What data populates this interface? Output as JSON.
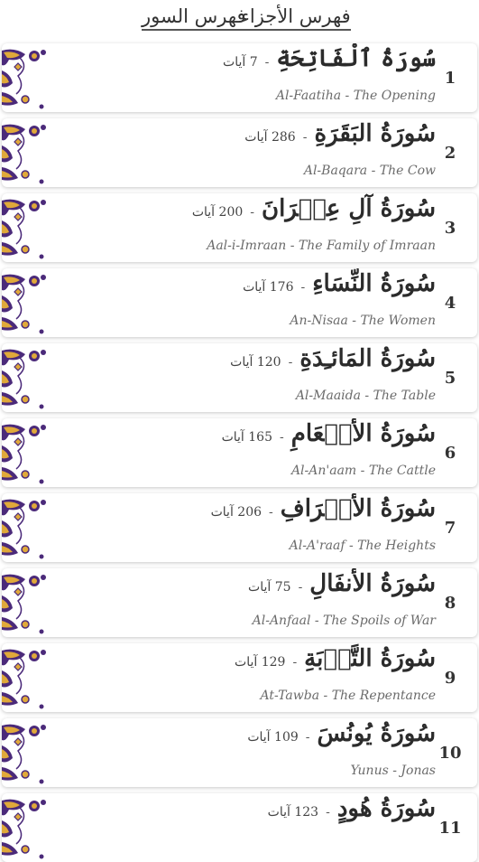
{
  "tabs": {
    "juz_index": "فهرس الأجزاء",
    "surah_index": "فهرس السور"
  },
  "colors": {
    "ornament_purple": "#4b2a7a",
    "ornament_gold": "#e0a93a"
  },
  "surahs": [
    {
      "number": "1",
      "arabic": "سُورَةُ ٱلْفَاتِحَةِ",
      "ayat": "7 آيات",
      "english": "Al-Faatiha - The Opening"
    },
    {
      "number": "2",
      "arabic": "سُورَةُ البَقَرَةِ",
      "ayat": "286 آيات",
      "english": "Al-Baqara - The Cow"
    },
    {
      "number": "3",
      "arabic": "سُورَةُ آلِ عِمۡرَانَ",
      "ayat": "200 آيات",
      "english": "Aal-i-Imraan - The Family of Imraan"
    },
    {
      "number": "4",
      "arabic": "سُورَةُ النِّسَاءِ",
      "ayat": "176 آيات",
      "english": "An-Nisaa - The Women"
    },
    {
      "number": "5",
      "arabic": "سُورَةُ المَائـِدَةِ",
      "ayat": "120 آيات",
      "english": "Al-Maaida - The Table"
    },
    {
      "number": "6",
      "arabic": "سُورَةُ الأَنۡعَامِ",
      "ayat": "165 آيات",
      "english": "Al-An'aam - The Cattle"
    },
    {
      "number": "7",
      "arabic": "سُورَةُ الأَعۡرَافِ",
      "ayat": "206 آيات",
      "english": "Al-A'raaf - The Heights"
    },
    {
      "number": "8",
      "arabic": "سُورَةُ الأَنفَالِ",
      "ayat": "75 آيات",
      "english": "Al-Anfaal - The Spoils of War"
    },
    {
      "number": "9",
      "arabic": "سُورَةُ التَّوۡبَةِ",
      "ayat": "129 آيات",
      "english": "At-Tawba - The Repentance"
    },
    {
      "number": "10",
      "arabic": "سُورَةُ يُونُسَ",
      "ayat": "109 آيات",
      "english": "Yunus - Jonas"
    },
    {
      "number": "11",
      "arabic": "سُورَةُ هُودٍ",
      "ayat": "123 آيات",
      "english": ""
    }
  ]
}
